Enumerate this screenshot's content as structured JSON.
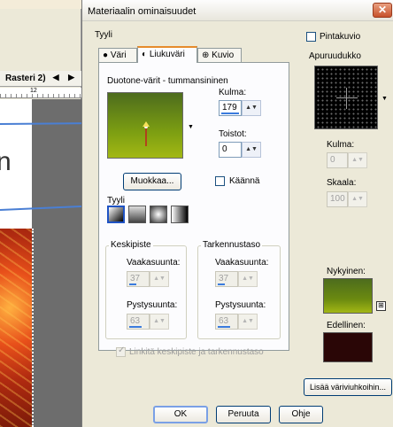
{
  "background": {
    "tab_label": "Rasteri 2)",
    "tab_arrows": "◀ ▶",
    "ruler_mark": "12",
    "slide_text": "n"
  },
  "dialog": {
    "title": "Materiaalin ominaisuudet",
    "close_glyph": "✕",
    "style_label": "Tyyli",
    "tabs": [
      {
        "label": "Väri",
        "icon": "filled-circle-icon"
      },
      {
        "label": "Liukuväri",
        "icon": "half-circle-icon"
      },
      {
        "label": "Kuvio",
        "icon": "pattern-icon"
      }
    ],
    "gradient_name": "Duotone-värit - tummansininen",
    "angle_label": "Kulma:",
    "angle_value": "179",
    "repeats_label": "Toistot:",
    "repeats_value": "0",
    "edit_button": "Muokkaa...",
    "invert_label": "Käännä",
    "style_section_label": "Tyyli",
    "center_group": {
      "label": "Keskipiste",
      "horizontal_label": "Vaakasuunta:",
      "horizontal_value": "37",
      "vertical_label": "Pystysuunta:",
      "vertical_value": "63"
    },
    "focus_group": {
      "label": "Tarkennustaso",
      "horizontal_label": "Vaakasuunta:",
      "horizontal_value": "37",
      "vertical_label": "Pystysuunta:",
      "vertical_value": "63"
    },
    "link_label": "Linkitä keskipiste ja tarkennustaso",
    "texture_label": "Pintakuvio",
    "picker_label": "Apuruudukko",
    "right_angle_label": "Kulma:",
    "right_angle_value": "0",
    "scale_label": "Skaala:",
    "scale_value": "100",
    "current_label": "Nykyinen:",
    "previous_label": "Edellinen:",
    "add_swatch_button": "Lisää väriviuhkoihin...",
    "ok_button": "OK",
    "cancel_button": "Peruuta",
    "help_button": "Ohje"
  },
  "colors": {
    "current_color": "#6b8a10",
    "previous_color": "#2a0606",
    "gradient_top": "#4d6c1d",
    "gradient_bottom": "#a3b814",
    "arrow_color": "#4a7fd4"
  }
}
